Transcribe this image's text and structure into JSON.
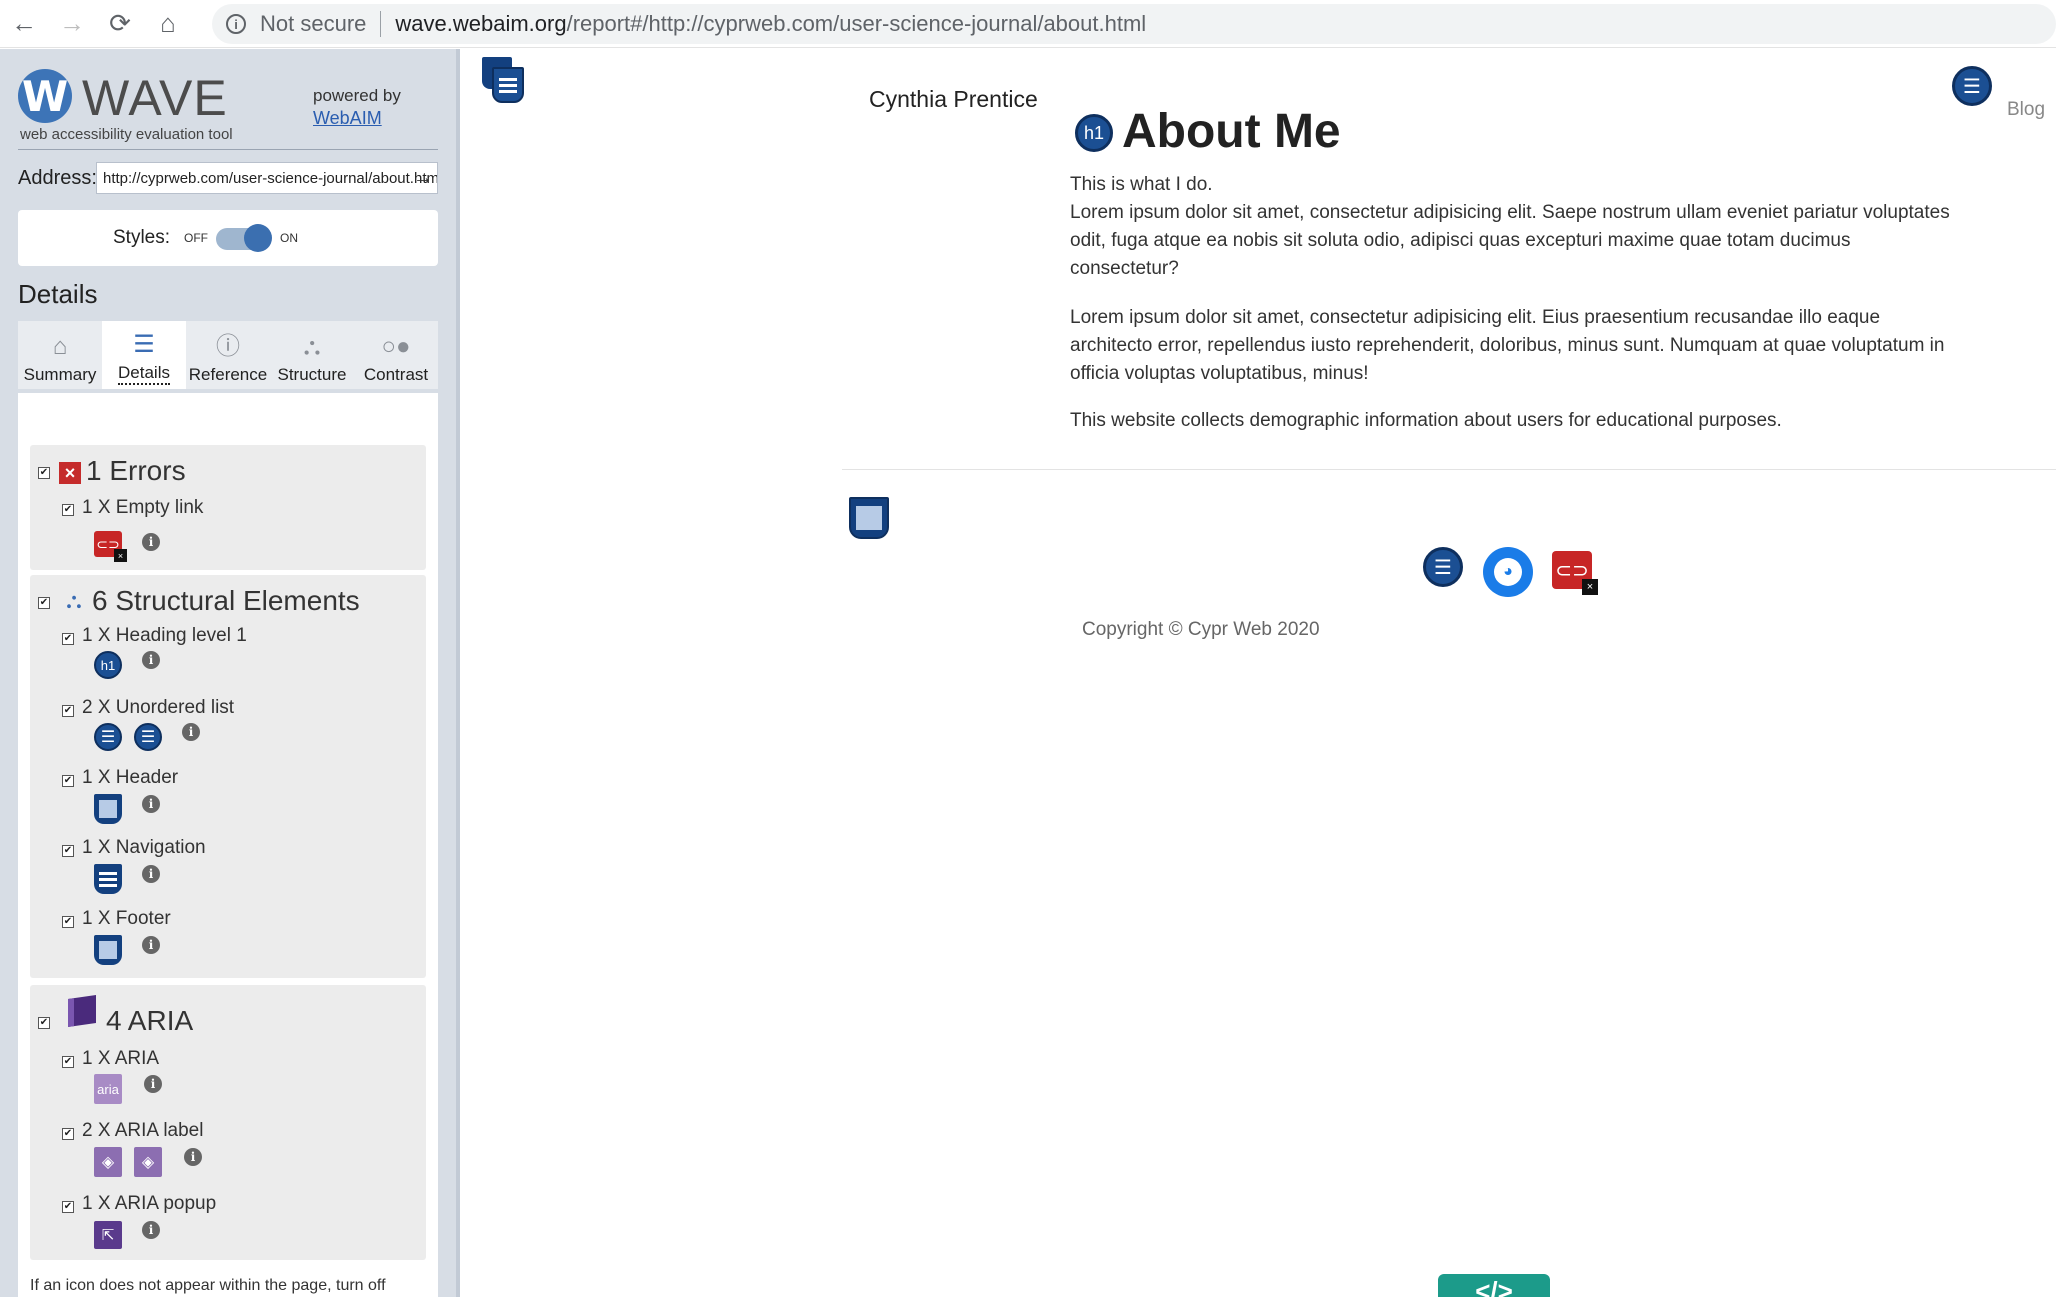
{
  "browser": {
    "back": "←",
    "forward": "→",
    "reload": "⟳",
    "home": "⌂",
    "security": "Not secure",
    "url_host": "wave.webaim.org",
    "url_path": "/report#/http://cyprweb.com/user-science-journal/about.html"
  },
  "wave": {
    "logo_letter": "W",
    "title": "WAVE",
    "subtitle": "web accessibility evaluation tool",
    "powered_by": "powered by",
    "webaim_link": "WebAIM",
    "address_label": "Address:",
    "address_value": "http://cyprweb.com/user-science-journal/about.html",
    "styles_label": "Styles:",
    "styles_off": "OFF",
    "styles_on": "ON",
    "styles_state": "on",
    "details_heading": "Details",
    "tabs": [
      {
        "label": "Summary",
        "icon": "home-icon"
      },
      {
        "label": "Details",
        "icon": "list-icon",
        "active": true
      },
      {
        "label": "Reference",
        "icon": "info-icon"
      },
      {
        "label": "Structure",
        "icon": "structure-icon"
      },
      {
        "label": "Contrast",
        "icon": "contrast-icon"
      }
    ],
    "errors": {
      "title": "1 Errors",
      "items": [
        {
          "label": "1 X Empty link"
        }
      ]
    },
    "structure": {
      "title": "6 Structural Elements",
      "items": [
        {
          "label": "1 X Heading level 1"
        },
        {
          "label": "2 X Unordered list"
        },
        {
          "label": "1 X Header"
        },
        {
          "label": "1 X Navigation"
        },
        {
          "label": "1 X Footer"
        }
      ]
    },
    "aria": {
      "title": "4 ARIA",
      "items": [
        {
          "label": "1 X ARIA"
        },
        {
          "label": "2 X ARIA label"
        },
        {
          "label": "1 X ARIA popup"
        }
      ]
    },
    "note": "If an icon does not appear within the page, turn off Styles above to view it.",
    "badge_h1": "h1",
    "badge_aria": "aria"
  },
  "page": {
    "site_name": "Cynthia Prentice",
    "blog_link": "Blog",
    "heading": "About Me",
    "paragraphs": [
      "This is what I do.",
      "Lorem ipsum dolor sit amet, consectetur adipisicing elit. Saepe nostrum ullam eveniet pariatur voluptates odit, fuga atque ea nobis sit soluta odio, adipisci quas excepturi maxime quae totam ducimus consectetur?",
      "Lorem ipsum dolor sit amet, consectetur adipisicing elit. Eius praesentium recusandae illo eaque architecto error, repellendus iusto reprehenderit, doloribus, minus sunt. Numquam at quae voluptatum in officia voluptas voluptatibus, minus!",
      "This website collects demographic information about users for educational purposes."
    ],
    "copyright": "Copyright © Cypr Web 2020",
    "code_badge": "</>"
  },
  "colors": {
    "wave_blue": "#3d74b7",
    "sidebar_bg": "#d7dde5",
    "error_red": "#c72626",
    "structure_navy": "#13407f",
    "aria_purple": "#8c6eb1",
    "github_blue": "#1a7ce8",
    "code_badge_teal": "#1c9b8a"
  }
}
